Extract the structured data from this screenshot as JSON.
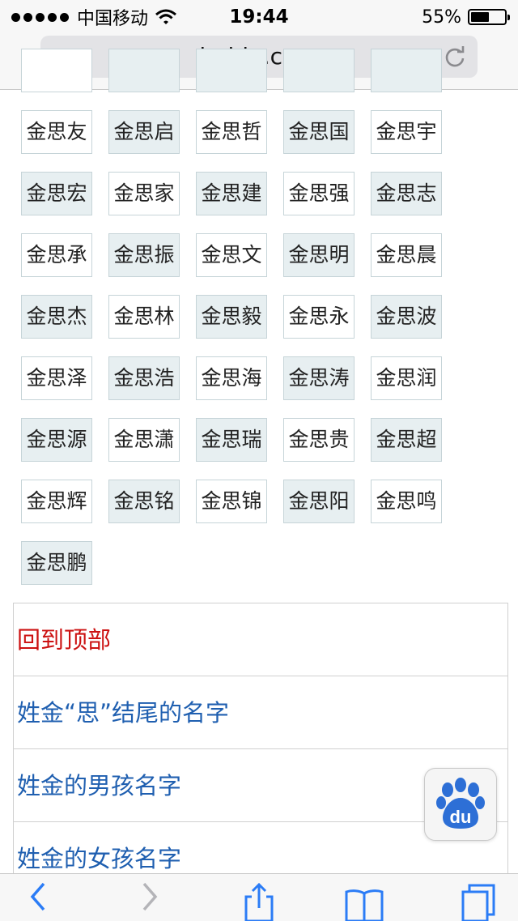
{
  "status_bar": {
    "carrier": "中国移动",
    "time": "19:44",
    "battery_percent_text": "55%",
    "battery_level": 0.55
  },
  "address_bar": {
    "url": "baidu.com"
  },
  "name_grid": {
    "names": [
      "金思友",
      "金思启",
      "金思哲",
      "金思国",
      "金思宇",
      "金思宏",
      "金思家",
      "金思建",
      "金思强",
      "金思志",
      "金思承",
      "金思振",
      "金思文",
      "金思明",
      "金思晨",
      "金思杰",
      "金思林",
      "金思毅",
      "金思永",
      "金思波",
      "金思泽",
      "金思浩",
      "金思海",
      "金思涛",
      "金思润",
      "金思源",
      "金思潇",
      "金思瑞",
      "金思贵",
      "金思超",
      "金思辉",
      "金思铭",
      "金思锦",
      "金思阳",
      "金思鸣",
      "金思鹏"
    ]
  },
  "links": {
    "back_to_top": "回到顶部",
    "items": [
      "姓金“思”结尾的名字",
      "姓金的男孩名字",
      "姓金的女孩名字"
    ]
  },
  "colors": {
    "link": "#1f5fb0",
    "back_to_top": "#cc1111",
    "baidu_blue": "#2d6fd6",
    "ios_blue": "#2b7cf6"
  },
  "icons": {
    "baidu_button": "baidu-paw-icon",
    "toolbar": [
      "back-icon",
      "forward-icon",
      "share-icon",
      "bookmarks-icon",
      "tabs-icon"
    ]
  }
}
